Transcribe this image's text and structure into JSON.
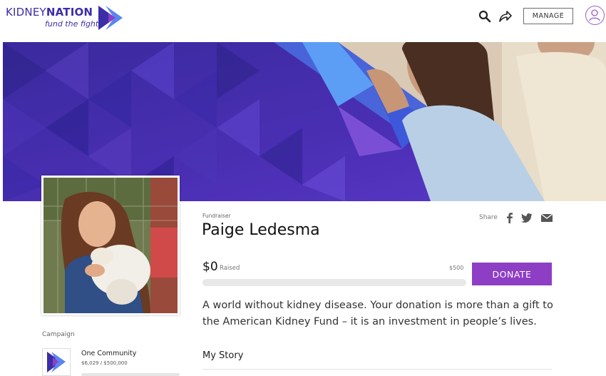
{
  "header": {
    "logo": {
      "wordmark_light": "KIDNEY",
      "wordmark_bold": "NATION",
      "tagline": "fund the fight"
    },
    "search_icon": "search-icon",
    "share_icon": "share-arrow-icon",
    "manage_label": "MANAGE",
    "avatar_icon": "user-avatar-icon"
  },
  "fundraiser": {
    "type_label": "Fundraiser",
    "name": "Paige Ledesma",
    "share_label": "Share",
    "share_icons": [
      "facebook-icon",
      "twitter-icon",
      "email-icon"
    ],
    "raised_amount": "$0",
    "raised_label": "Raised",
    "goal": "$500",
    "progress_fraction": 0,
    "donate_label": "DONATE",
    "description": "A world without kidney disease. Your donation is more than a gift to the American Kidney Fund – it is an investment in people’s lives.",
    "story_heading": "My Story"
  },
  "campaign": {
    "section_label": "Campaign",
    "name": "One Community",
    "progress_text": "$6,029 / $500,000",
    "progress_fraction": 0.012
  },
  "colors": {
    "brand_purple": "#8e3ec4",
    "brand_navy": "#3b2ea8",
    "banner_blue": "#4a6fe0"
  }
}
